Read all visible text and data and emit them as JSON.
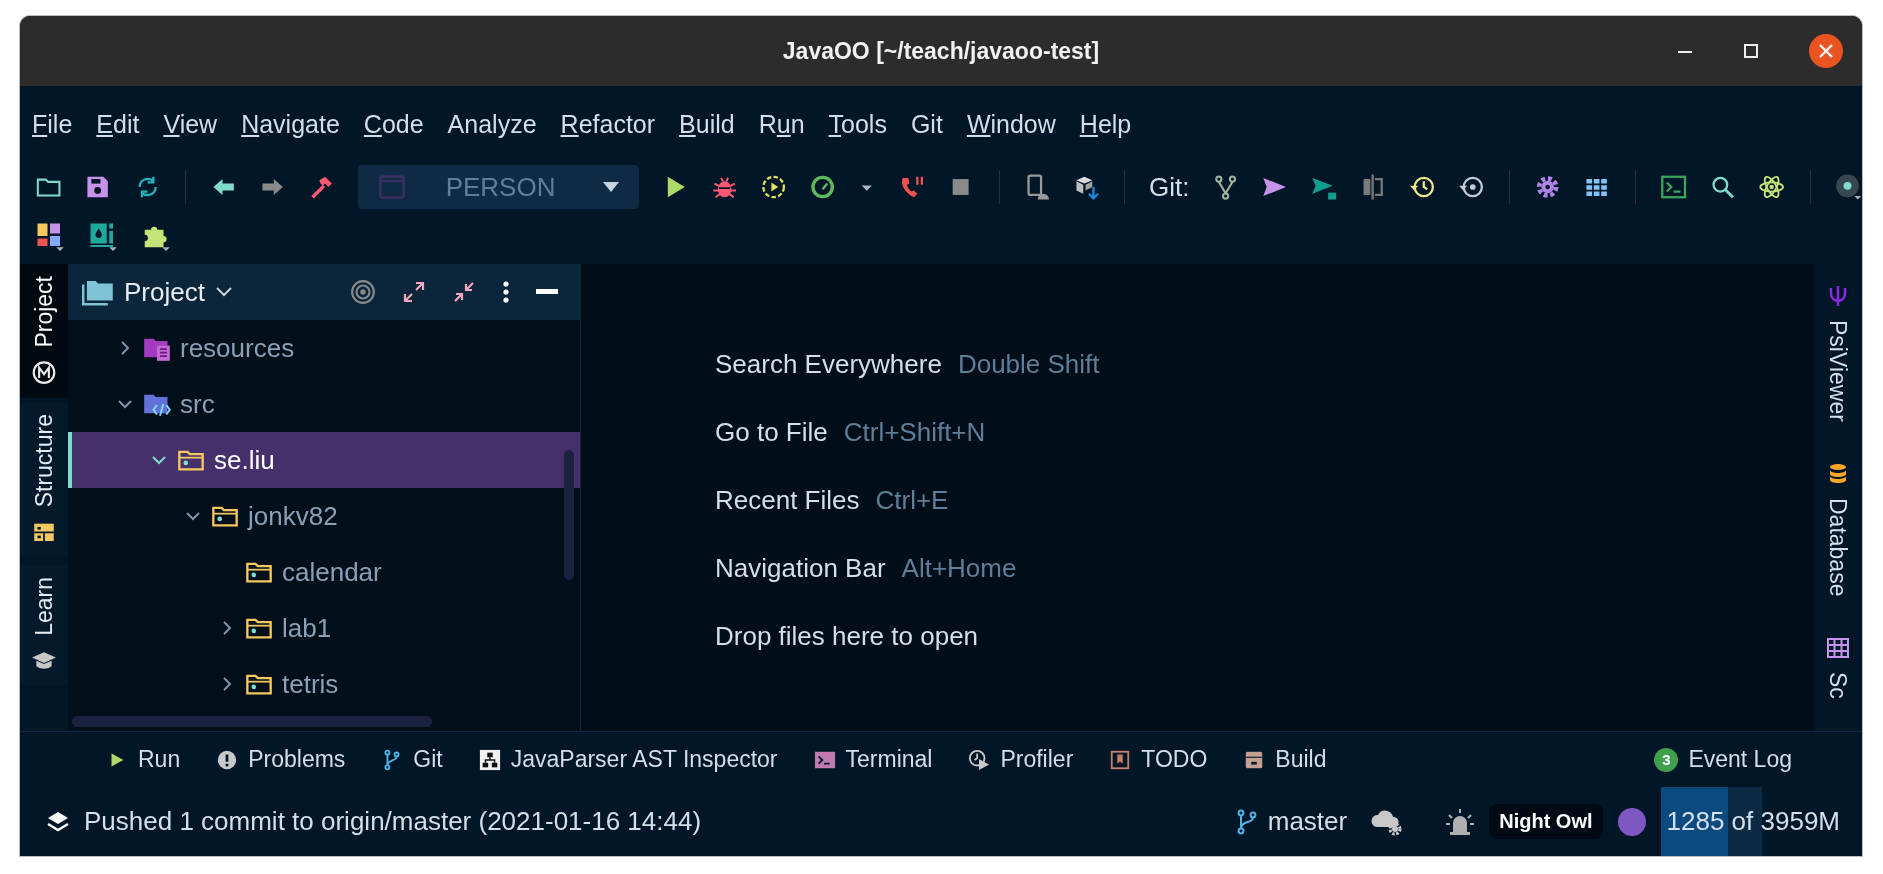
{
  "window": {
    "title": "JavaOO [~/teach/javaoo-test]"
  },
  "menu": [
    {
      "key": "F",
      "rest": "ile"
    },
    {
      "key": "E",
      "rest": "dit"
    },
    {
      "key": "V",
      "rest": "iew"
    },
    {
      "key": "N",
      "rest": "avigate"
    },
    {
      "key": "C",
      "rest": "ode"
    },
    {
      "rest": "Analyze"
    },
    {
      "key": "R",
      "rest": "efactor"
    },
    {
      "key": "B",
      "rest": "uild"
    },
    {
      "pre": "R",
      "key": "u",
      "rest": "n"
    },
    {
      "key": "T",
      "rest": "ools"
    },
    {
      "rest": "Git"
    },
    {
      "key": "W",
      "rest": "indow"
    },
    {
      "key": "H",
      "rest": "elp"
    }
  ],
  "toolbar": {
    "run_config": "PERSON",
    "git_label": "Git:"
  },
  "left_stripe": [
    {
      "label": "Project",
      "selected": true
    },
    {
      "label": "Structure",
      "selected": false
    },
    {
      "label": "Learn",
      "selected": false
    }
  ],
  "project": {
    "title": "Project",
    "tree": [
      {
        "label": "resources",
        "kind": "resources",
        "expanded": false,
        "selected": false
      },
      {
        "label": "src",
        "kind": "source",
        "expanded": true,
        "selected": false,
        "children": [
          {
            "label": "se.liu",
            "kind": "package",
            "expanded": true,
            "selected": true,
            "children": [
              {
                "label": "jonkv82",
                "kind": "package",
                "expanded": true,
                "selected": false,
                "children": [
                  {
                    "label": "calendar",
                    "kind": "package",
                    "selected": false
                  },
                  {
                    "label": "lab1",
                    "kind": "package",
                    "expanded": false,
                    "selected": false
                  },
                  {
                    "label": "tetris",
                    "kind": "package",
                    "expanded": false,
                    "selected": false
                  }
                ]
              }
            ]
          }
        ]
      }
    ]
  },
  "editor_hints": [
    {
      "action": "Search Everywhere",
      "shortcut": "Double Shift"
    },
    {
      "action": "Go to File",
      "shortcut": "Ctrl+Shift+N"
    },
    {
      "action": "Recent Files",
      "shortcut": "Ctrl+E"
    },
    {
      "action": "Navigation Bar",
      "shortcut": "Alt+Home"
    },
    {
      "action": "Drop files here to open"
    }
  ],
  "right_stripe": [
    {
      "label": "PsiViewer"
    },
    {
      "label": "Database"
    },
    {
      "label": "Sc"
    }
  ],
  "tool_windows": [
    {
      "label": "Run"
    },
    {
      "label": "Problems"
    },
    {
      "label": "Git"
    },
    {
      "label": "JavaParser AST Inspector"
    },
    {
      "label": "Terminal"
    },
    {
      "label": "Profiler"
    },
    {
      "label": "TODO"
    },
    {
      "label": "Build"
    },
    {
      "label": "Event Log",
      "badge": "3"
    }
  ],
  "status_bar": {
    "message": "Pushed 1 commit to origin/master (2021-01-16 14:44)",
    "branch": "master",
    "theme": "Night Owl",
    "memory": {
      "text": "1285 of 3959M",
      "level": 0.67
    }
  }
}
